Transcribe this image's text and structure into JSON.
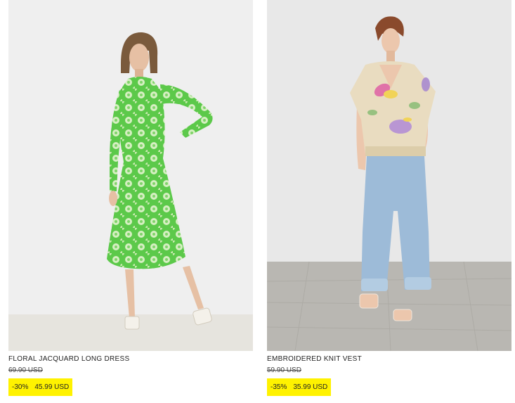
{
  "products": [
    {
      "name": "FLORAL JACQUARD LONG DRESS",
      "original_price": "69.90 USD",
      "discount": "-30%",
      "sale_price": "45.99 USD",
      "image_alt": "Model wearing green floral jacquard long dress"
    },
    {
      "name": "EMBROIDERED KNIT VEST",
      "original_price": "59.90 USD",
      "discount": "-35%",
      "sale_price": "35.99 USD",
      "image_alt": "Model wearing embroidered knit vest and light blue jeans"
    }
  ],
  "colors": {
    "sale_highlight": "#fff200",
    "dress_green": "#5cc94a",
    "vest_cream": "#e9dcc0",
    "jeans_blue": "#9dbbd8"
  }
}
